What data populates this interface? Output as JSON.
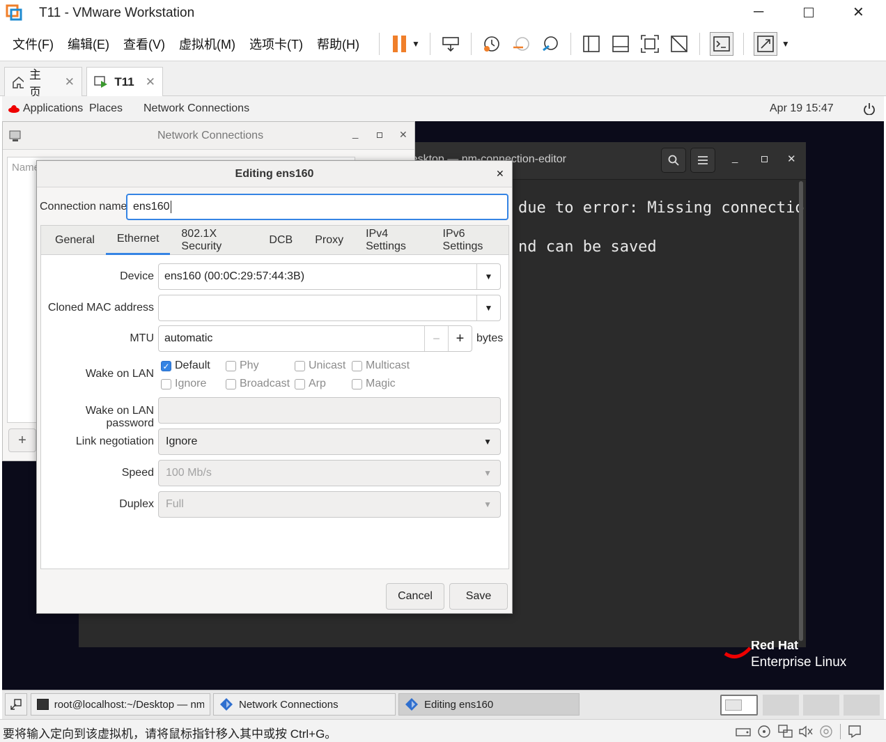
{
  "window": {
    "title": "T11 - VMware Workstation"
  },
  "menu": [
    "文件(F)",
    "编辑(E)",
    "查看(V)",
    "虚拟机(M)",
    "选项卡(T)",
    "帮助(H)"
  ],
  "tabs": {
    "home": "主页",
    "vm": "T11"
  },
  "gnome": {
    "applications": "Applications",
    "places": "Places",
    "app": "Network Connections",
    "clock": "Apr 19  15:47"
  },
  "terminal": {
    "title": "root@localhost:~/Desktop — nm-connection-editor",
    "line1": "due to error: Missing connectio",
    "line2": "nd can be saved"
  },
  "nc_window": {
    "title": "Network Connections",
    "col_name": "Name",
    "add": "+"
  },
  "editor": {
    "title": "Editing ens160",
    "conn_label": "Connection name",
    "conn_value": "ens160",
    "tabs": [
      "General",
      "Ethernet",
      "802.1X Security",
      "DCB",
      "Proxy",
      "IPv4 Settings",
      "IPv6 Settings"
    ],
    "device_label": "Device",
    "device_value": "ens160 (00:0C:29:57:44:3B)",
    "cloned_label": "Cloned MAC address",
    "cloned_value": "",
    "mtu_label": "MTU",
    "mtu_value": "automatic",
    "mtu_unit": "bytes",
    "wol_label": "Wake on LAN",
    "wol_options": [
      {
        "label": "Default",
        "checked": true
      },
      {
        "label": "Phy",
        "checked": false
      },
      {
        "label": "Unicast",
        "checked": false
      },
      {
        "label": "Multicast",
        "checked": false
      },
      {
        "label": "Ignore",
        "checked": false
      },
      {
        "label": "Broadcast",
        "checked": false
      },
      {
        "label": "Arp",
        "checked": false
      },
      {
        "label": "Magic",
        "checked": false
      }
    ],
    "wolpw_label": "Wake on LAN password",
    "link_label": "Link negotiation",
    "link_value": "Ignore",
    "speed_label": "Speed",
    "speed_value": "100 Mb/s",
    "duplex_label": "Duplex",
    "duplex_value": "Full",
    "cancel": "Cancel",
    "save": "Save"
  },
  "rhel": {
    "line1": "Red Hat",
    "line2": "Enterprise Linux"
  },
  "taskbar": [
    "root@localhost:~/Desktop — nm-...",
    "Network Connections",
    "Editing ens160"
  ],
  "status": "要将输入定向到该虚拟机，请将鼠标指针移入其中或按 Ctrl+G。",
  "colors": {
    "accent": "#3584e4",
    "pause": "#f07f2a",
    "rhel_red": "#ee0000"
  }
}
